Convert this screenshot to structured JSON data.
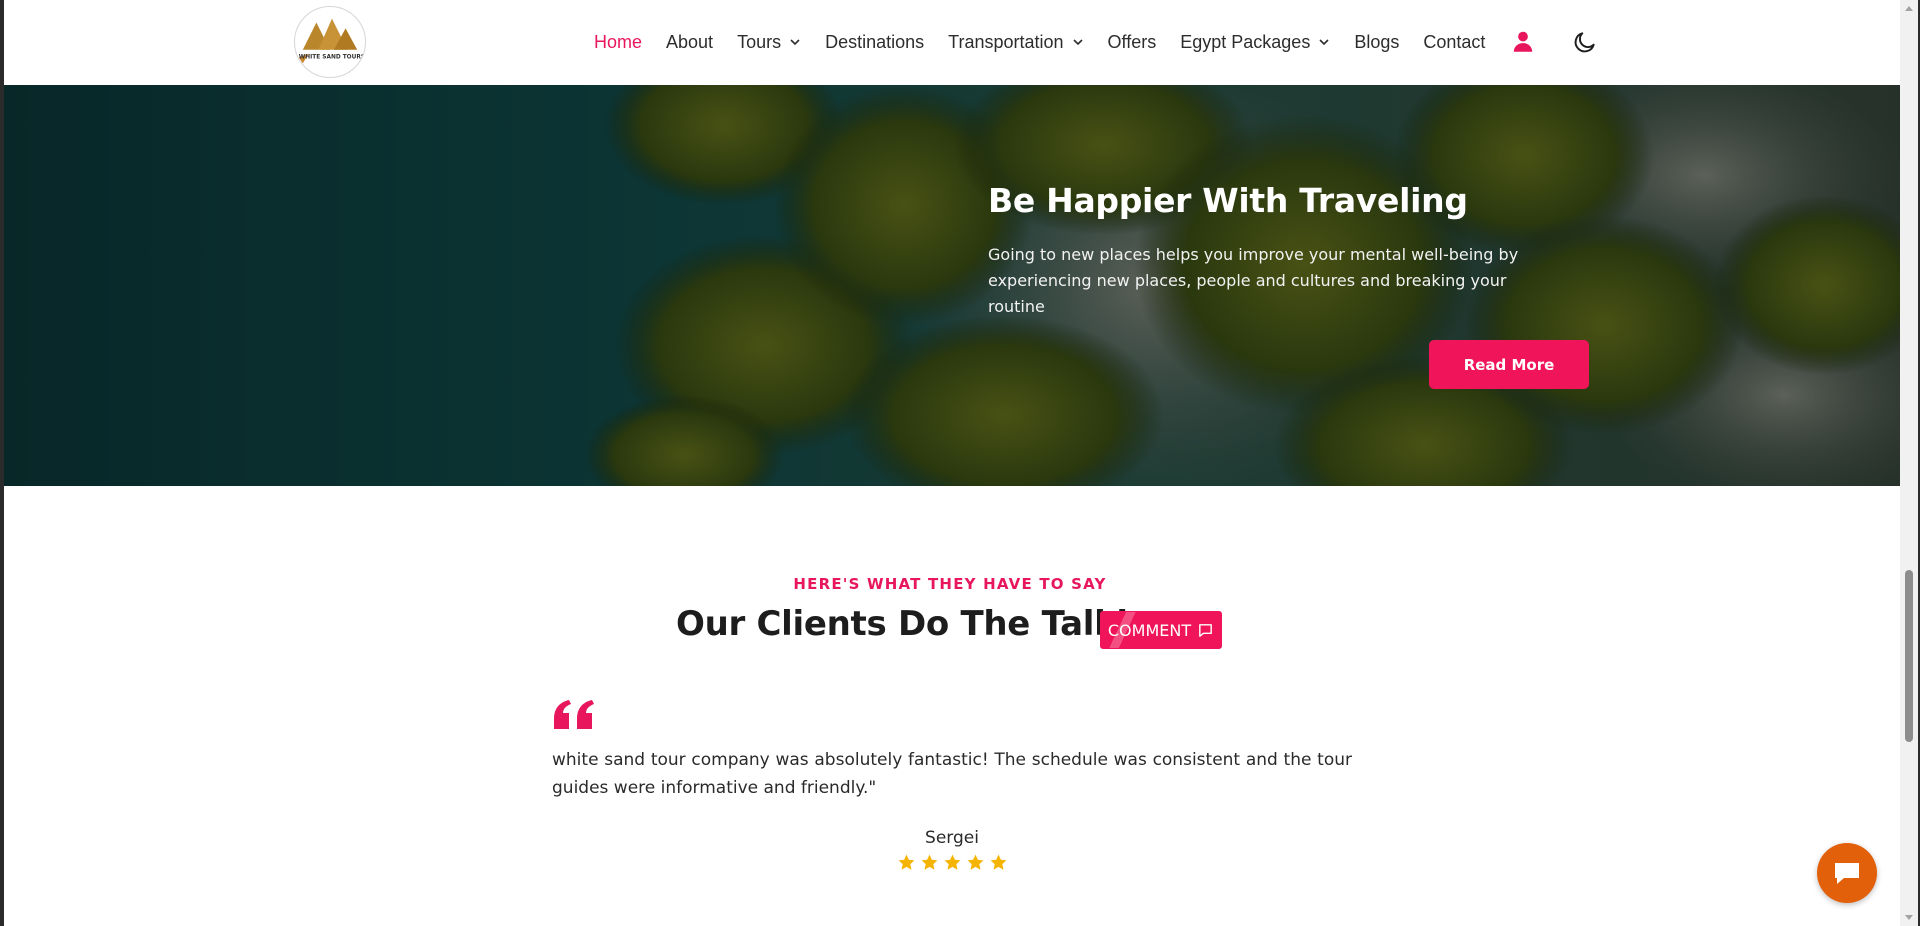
{
  "nav": {
    "logo_text": "WHITE SAND TOURS",
    "items": [
      {
        "label": "Home",
        "active": true,
        "dropdown": false
      },
      {
        "label": "About",
        "active": false,
        "dropdown": false
      },
      {
        "label": "Tours",
        "active": false,
        "dropdown": true
      },
      {
        "label": "Destinations",
        "active": false,
        "dropdown": false
      },
      {
        "label": "Transportation",
        "active": false,
        "dropdown": true
      },
      {
        "label": "Offers",
        "active": false,
        "dropdown": false
      },
      {
        "label": "Egypt Packages",
        "active": false,
        "dropdown": true
      },
      {
        "label": "Blogs",
        "active": false,
        "dropdown": false
      },
      {
        "label": "Contact",
        "active": false,
        "dropdown": false
      }
    ],
    "user_icon": "user-icon",
    "theme_icon": "moon-icon"
  },
  "hero": {
    "title": "Be Happier With Traveling",
    "text": "Going to new places helps you improve your mental well-being by experiencing new places, people and cultures and breaking your routine",
    "button_label": "Read More"
  },
  "testimonials": {
    "eyebrow": "HERE'S WHAT THEY HAVE TO SAY",
    "title": "Our Clients Do The Talking",
    "comment_button": "COMMENT",
    "quote": "white sand tour company was absolutely fantastic! The schedule was consistent and the tour guides were informative and friendly.\"",
    "author": "Sergei",
    "rating": 5,
    "rating_max": 5
  },
  "colors": {
    "accent": "#e8175d",
    "button": "#f0145a",
    "star": "#f5b400",
    "chat": "#e2600a"
  },
  "chat": {
    "icon": "chat-bubble-icon"
  }
}
